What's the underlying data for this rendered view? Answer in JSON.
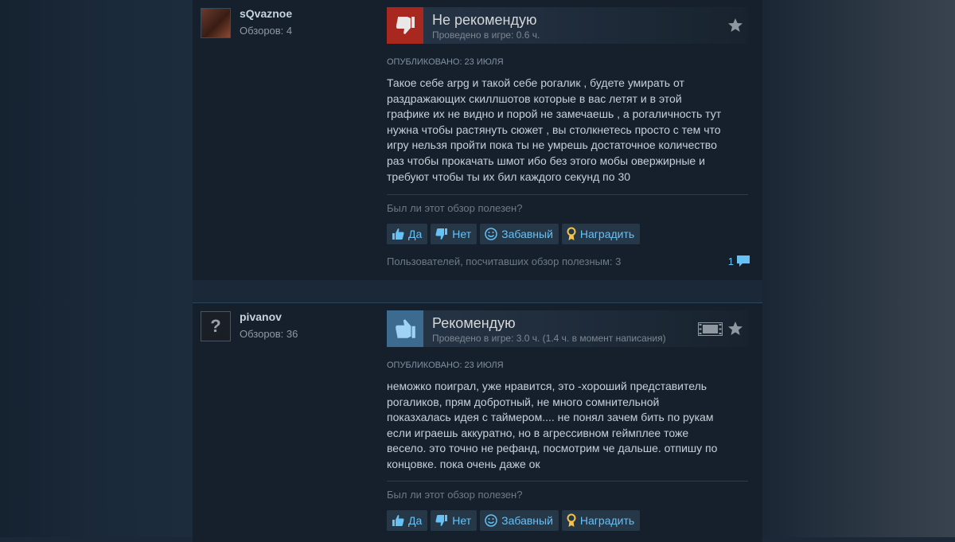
{
  "common": {
    "helpful_question": "Был ли этот обзор полезен?",
    "btn_yes": "Да",
    "btn_no": "Нет",
    "btn_funny": "Забавный",
    "btn_award": "Наградить"
  },
  "reviews": [
    {
      "username": "sQvaznoe",
      "reviews_count": "Обзоров: 4",
      "verdict": "Не рекомендую",
      "hours": "Проведено в игре: 0.6 ч.",
      "posted": "ОПУБЛИКОВАНО: 23 ИЮЛЯ",
      "text_lines": [
        "Такое себе arpg и такой себе рогалик , будете умирать от",
        "раздражающих скиллшотов которые в вас летят и в этой",
        "графике их не видно и порой не замечаешь , а рогаличность тут",
        "нужна чтобы растянуть сюжет , вы столкнетесь просто с тем что",
        "игру нельзя пройти пока ты не умрешь достаточное количество",
        "раз чтобы прокачать шмот ибо без этого мобы овержирные и",
        "требуют чтобы ты их бил каждого секунд по 30"
      ],
      "helpful_count": "Пользователей, посчитавших обзор полезным: 3",
      "comments": "1",
      "colors": {
        "verdict_bg": "#a8281f"
      }
    },
    {
      "username": "pivanov",
      "reviews_count": "Обзоров: 36",
      "avatar_glyph": "?",
      "verdict": "Рекомендую",
      "hours": "Проведено в игре: 3.0 ч. (1.4 ч. в момент написания)",
      "posted": "ОПУБЛИКОВАНО: 23 ИЮЛЯ",
      "text_lines": [
        "неможко поиграл, уже нравится, это -хороший представитель",
        "рогаликов, прям добротный, не много сомнительной",
        "показхалась идея с таймером.... не понял зачем бить по рукам",
        "если играешь аккуратно, но в агрессивном геймплее тоже",
        "весело. это точно не рефанд, посмотрим че дальше. отпишу по",
        "концовке. пока очень даже ок"
      ],
      "colors": {
        "verdict_bg": "#3c6b8f"
      }
    }
  ]
}
